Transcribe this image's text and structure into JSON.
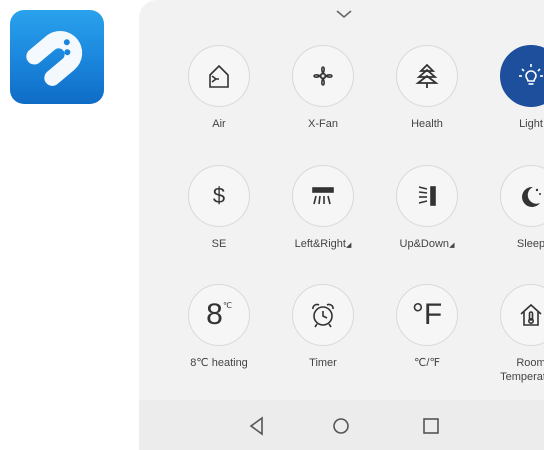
{
  "app": {
    "icon_name": "remote-app-icon"
  },
  "buttons": [
    {
      "id": "air",
      "label": "Air",
      "icon": "house-fan-icon"
    },
    {
      "id": "xfan",
      "label": "X-Fan",
      "icon": "fan-icon"
    },
    {
      "id": "health",
      "label": "Health",
      "icon": "tree-icon"
    },
    {
      "id": "light",
      "label": "Light",
      "icon": "bulb-icon",
      "active": true
    },
    {
      "id": "se",
      "label": "SE",
      "icon": "dollar-icon",
      "glyph": "$"
    },
    {
      "id": "leftright",
      "label": "Left&Right",
      "icon": "swing-horizontal-icon"
    },
    {
      "id": "updown",
      "label": "Up&Down",
      "icon": "swing-vertical-icon"
    },
    {
      "id": "sleep",
      "label": "Sleep",
      "icon": "moon-icon"
    },
    {
      "id": "heating8",
      "label": "8℃ heating",
      "icon": "heating-8c-icon",
      "glyph": "8",
      "glyph_sup": "℃"
    },
    {
      "id": "timer",
      "label": "Timer",
      "icon": "alarm-clock-icon"
    },
    {
      "id": "unit",
      "label": "℃/℉",
      "icon": "fahrenheit-icon",
      "glyph": "°F"
    },
    {
      "id": "roomtemp",
      "label": "Room Temperature",
      "icon": "house-thermometer-icon"
    }
  ],
  "colors": {
    "active": "#1d4f9c",
    "panel": "#f2f2f2"
  }
}
